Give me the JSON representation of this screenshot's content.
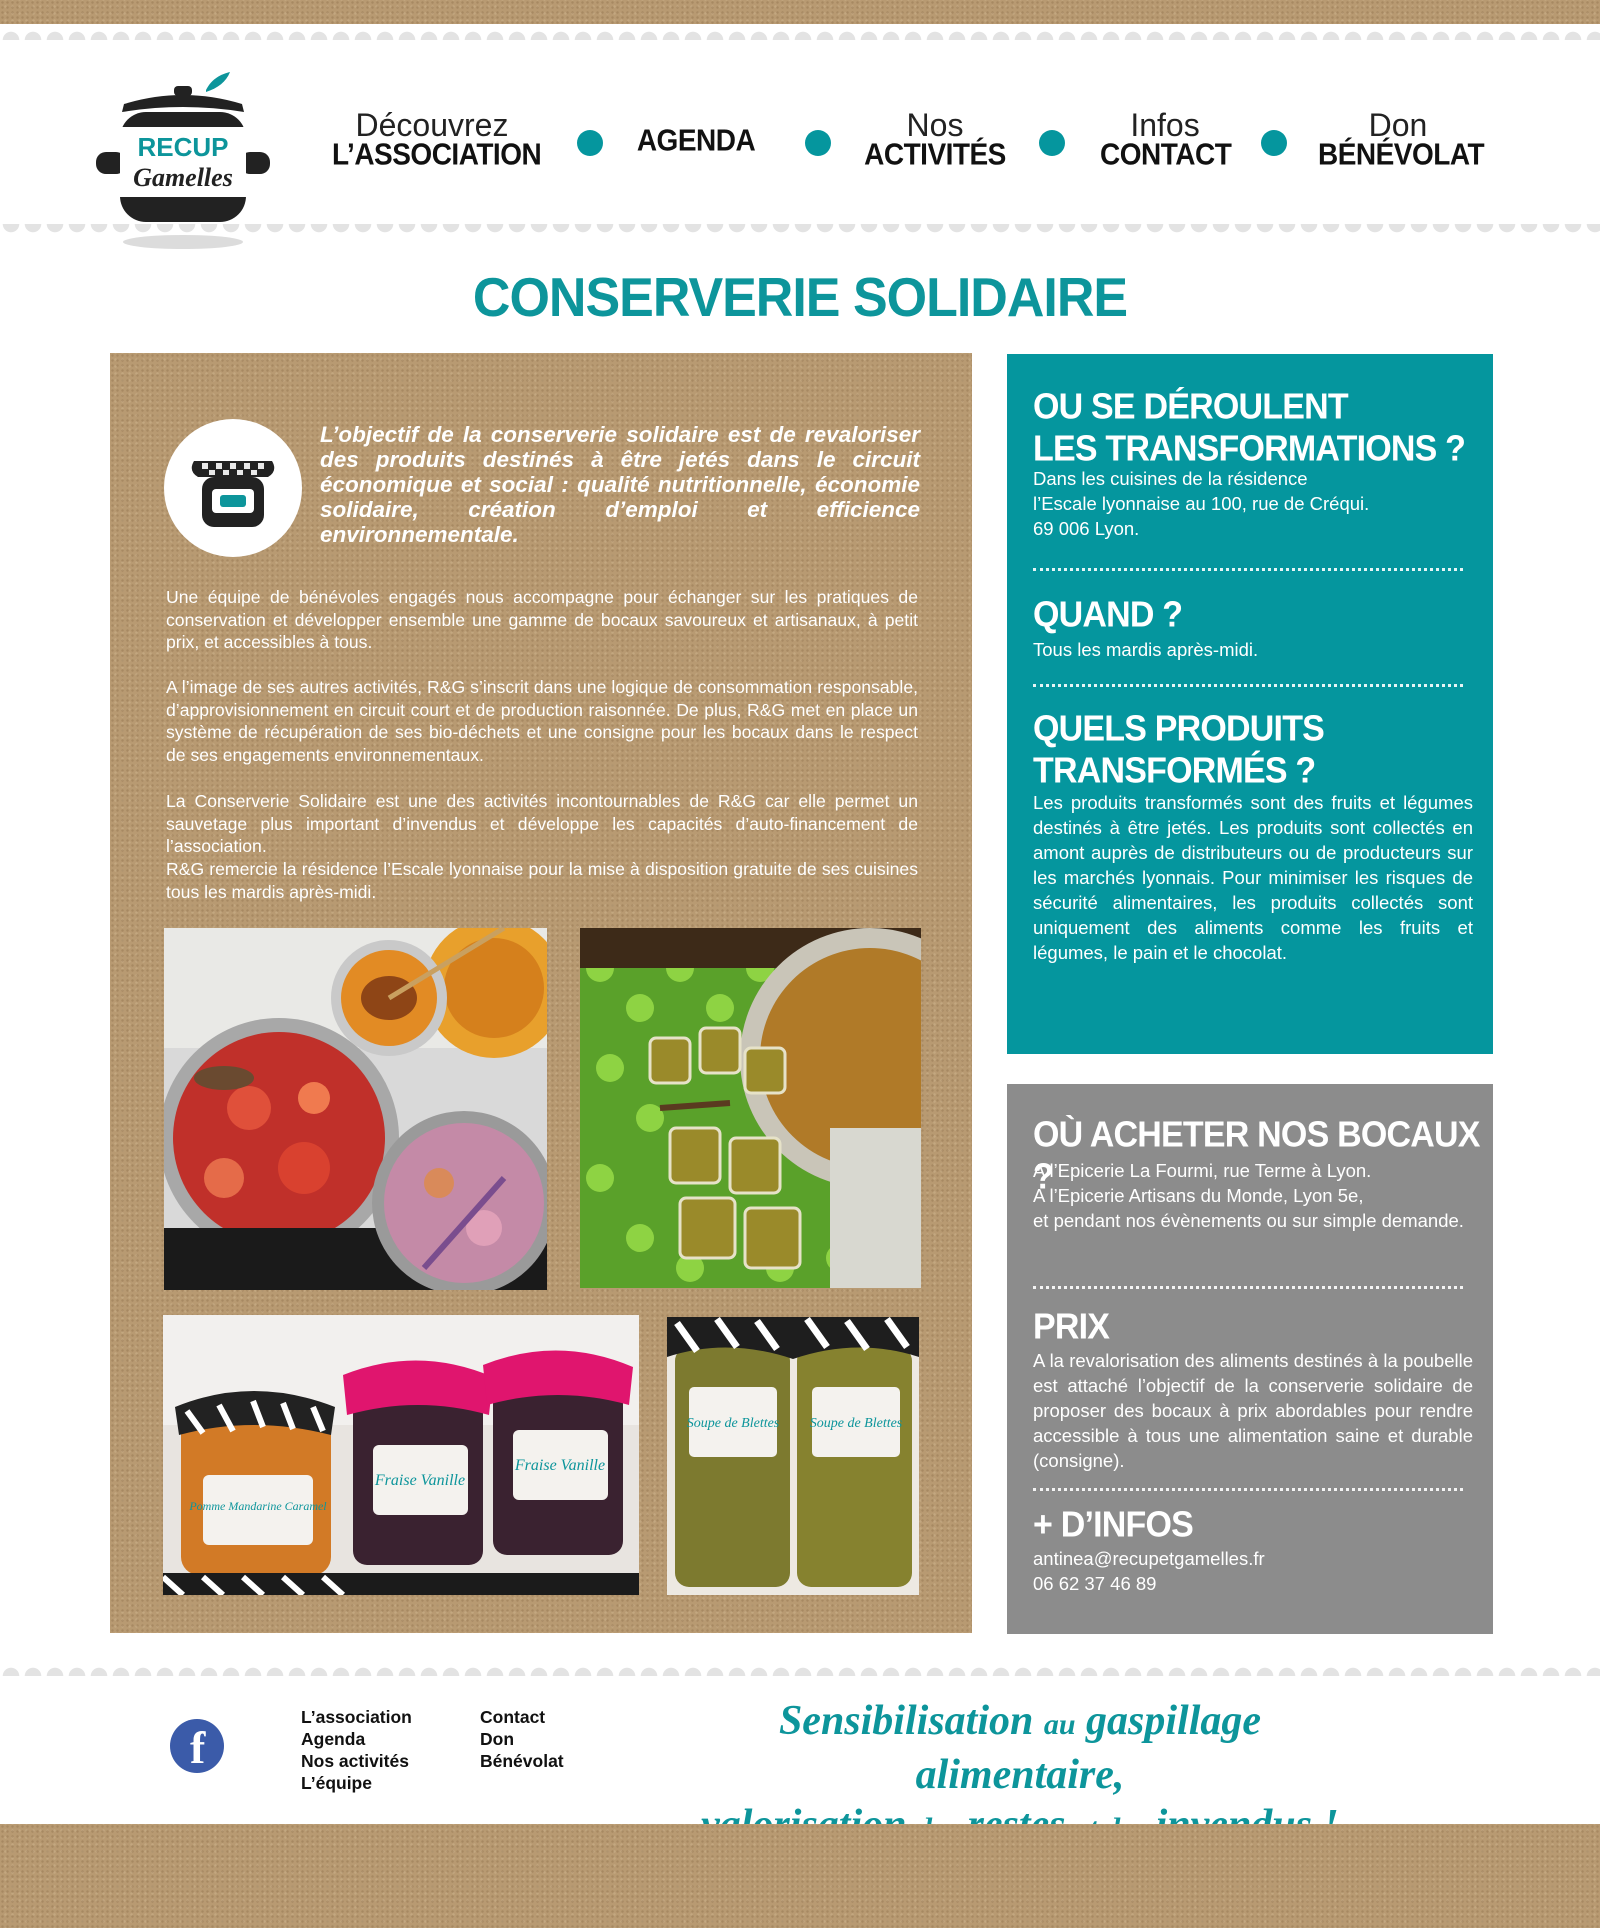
{
  "header": {
    "logo_text": [
      "RECUP",
      "Gamelles"
    ],
    "nav": [
      {
        "top": "Découvrez",
        "bottom": "L’ASSOCIATION"
      },
      {
        "top": "",
        "bottom": "AGENDA"
      },
      {
        "top": "Nos",
        "bottom": "ACTIVITÉS"
      },
      {
        "top": "Infos",
        "bottom": "CONTACT"
      },
      {
        "top": "Don",
        "bottom": "BÉNÉVOLAT"
      }
    ]
  },
  "page_title": "CONSERVERIE SOLIDAIRE",
  "main": {
    "intro": "L’objectif de la conserverie solidaire est de revaloriser des produits destinés à être jetés dans le circuit économique et social : qualité nutritionnelle, économie solidaire, création d’emploi et efficience environnementale.",
    "paragraphs": [
      "Une équipe de bénévoles engagés nous accompagne pour échanger sur les pratiques de conservation et développer ensemble une gamme de bocaux savoureux et artisanaux, à petit prix, et accessibles à tous.",
      "A l’image de ses autres activités, R&G s’inscrit dans une logique de consommation responsable, d’approvisionnement en circuit court et de production raisonnée. De plus, R&G met en place un système de récupération de ses bio-déchets et une consigne pour les bocaux dans le respect de ses engagements environnementaux.",
      "La Conserverie Solidaire est une des activités incontournables de R&G car elle permet un sauvetage plus important d’invendus et développe les capacités d’auto-financement de l’association.",
      "R&G remercie la résidence l’Escale lyonnaise pour la mise à disposition gratuite de ses cuisines tous les mardis après-midi."
    ],
    "jar_labels": [
      "Pomme Mandarine Caramel",
      "Fraise Vanille",
      "Fraise Vanille",
      "Soupe de Blettes",
      "Soupe de Blettes"
    ]
  },
  "teal_panel": {
    "q1_title_line1": "OU SE DÉROULENT",
    "q1_title_line2": "LES TRANSFORMATIONS ?",
    "q1_text": [
      "Dans les cuisines de la résidence",
      "l’Escale lyonnaise au 100, rue de Créqui.",
      "69 006 Lyon."
    ],
    "q2_title": "QUAND ?",
    "q2_text": "Tous les mardis après-midi.",
    "q3_title_line1": "QUELS PRODUITS",
    "q3_title_line2": "TRANSFORMÉS ?",
    "q3_text": "Les produits transformés sont des fruits et légumes destinés à être jetés. Les produits sont collectés en amont auprès de distributeurs ou de producteurs sur les marchés lyonnais. Pour minimiser les risques de sécurité alimentaires, les produits collectés sont uniquement des aliments comme les fruits et légumes, le pain et le chocolat."
  },
  "grey_panel": {
    "buy_title": "OÙ ACHETER NOS BOCAUX ?",
    "buy_text": [
      "A l’Epicerie La Fourmi, rue Terme à Lyon.",
      "A l’Epicerie Artisans du Monde, Lyon 5e,",
      "et pendant nos évènements ou sur simple demande."
    ],
    "price_title": "PRIX",
    "price_text": "A la revalorisation des aliments destinés à la poubelle est attaché l’objectif de la conserverie solidaire de proposer des bocaux à prix abordables pour rendre accessible à tous une alimentation saine et durable (consigne).",
    "info_title": "+ D’INFOS",
    "info_email": "antinea@recupetgamelles.fr",
    "info_phone": "06 62 37 46 89"
  },
  "footer": {
    "col1": [
      "L’association",
      "Agenda",
      "Nos activités",
      "L’équipe"
    ],
    "col2": [
      "Contact",
      "Don",
      "Bénévolat"
    ],
    "tagline": {
      "a": "Sensibilisation",
      "b": "au",
      "c": "gaspillage alimentaire,",
      "d": "valorisation",
      "e": "des",
      "f": "restes",
      "g": "et des",
      "h": "invendus !"
    },
    "facebook_icon": "facebook-icon"
  },
  "colors": {
    "teal": "#05969e",
    "grey": "#8c8c8c",
    "kraft": "#b89a72",
    "facebook": "#3b5ba9"
  }
}
